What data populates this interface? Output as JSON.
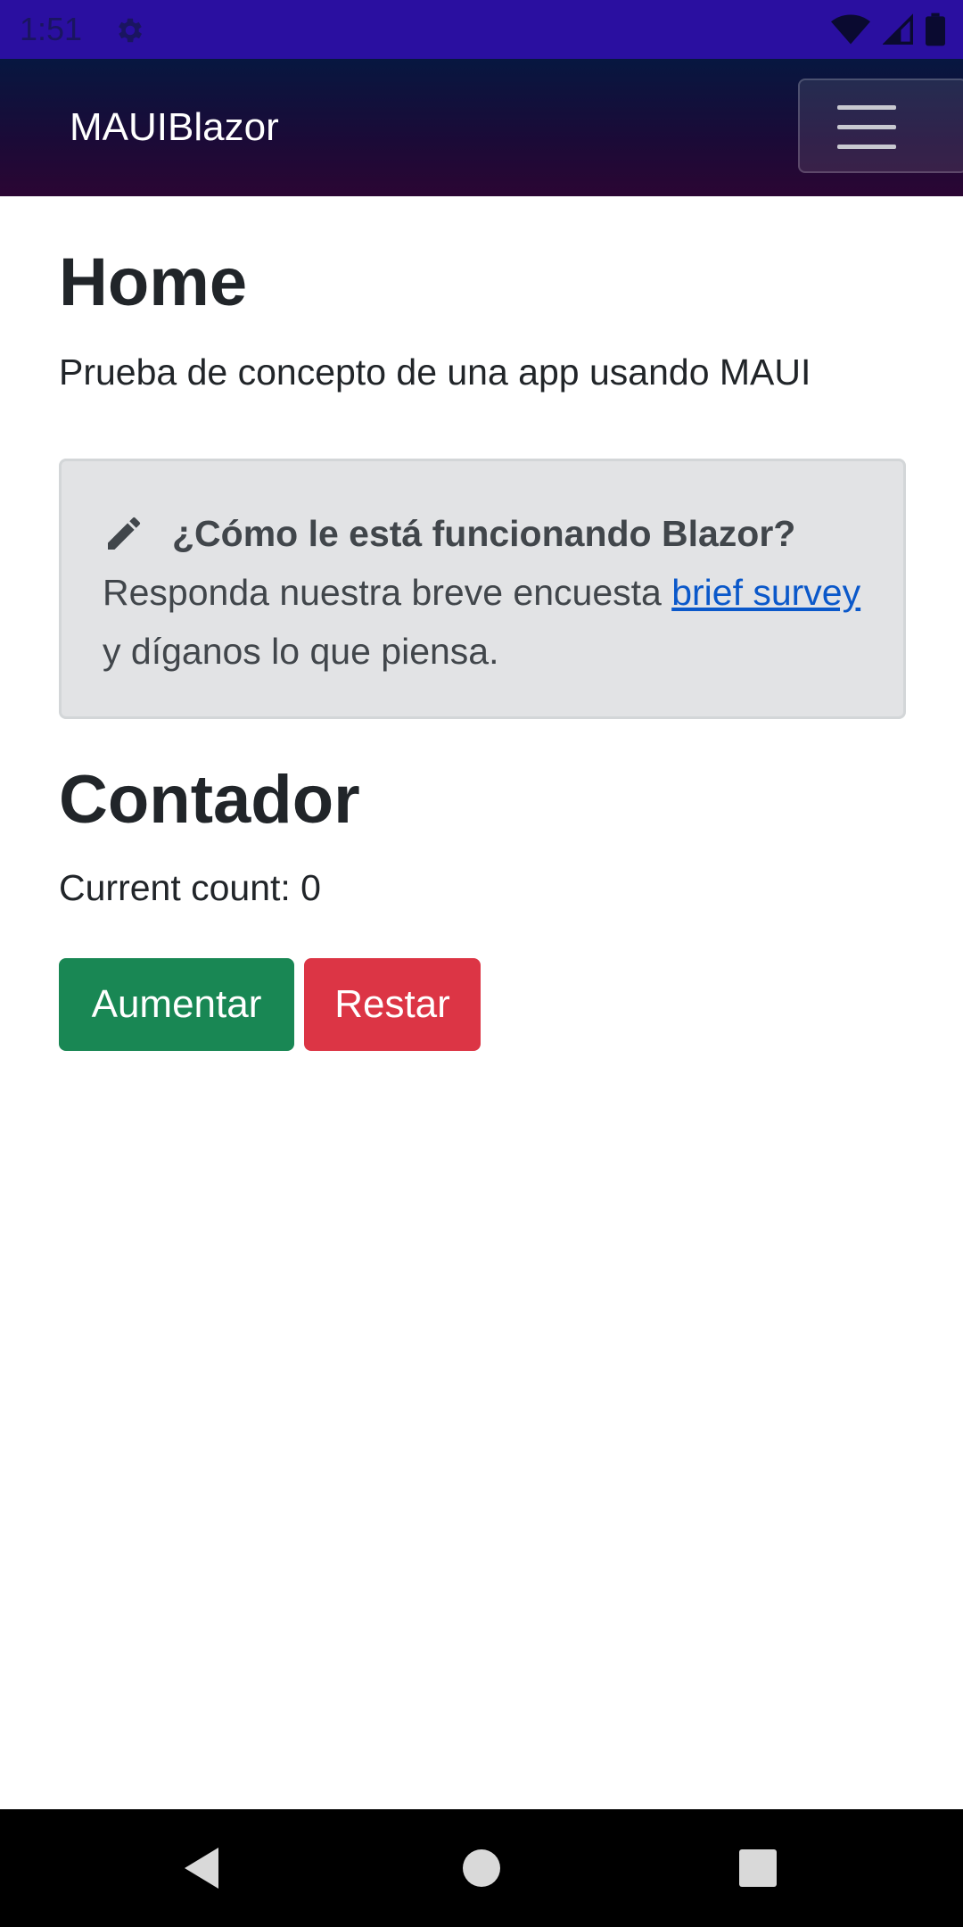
{
  "status_bar": {
    "time": "1:51",
    "icons": [
      "settings-icon",
      "wifi-icon",
      "signal-icon",
      "battery-icon"
    ],
    "background": "#2a0fa0"
  },
  "navbar": {
    "brand": "MAUIBlazor",
    "menu_icon": "hamburger-menu-icon"
  },
  "page": {
    "title": "Home",
    "intro": "Prueba de concepto de una app usando MAUI"
  },
  "survey_alert": {
    "icon": "pencil-icon",
    "title": "¿Cómo le está funcionando Blazor?",
    "text_before": "Responda nuestra breve encuesta ",
    "link_text": "brief survey",
    "text_after": "y díganos lo que piensa.",
    "background": "#e2e3e5"
  },
  "counter": {
    "heading": "Contador",
    "count_text": "Current count: 0",
    "increment_label": "Aumentar",
    "decrement_label": "Restar",
    "increment_color": "#198754",
    "decrement_color": "#dc3545"
  },
  "system_nav": {
    "buttons": [
      "back-icon",
      "home-icon",
      "recents-icon"
    ]
  }
}
